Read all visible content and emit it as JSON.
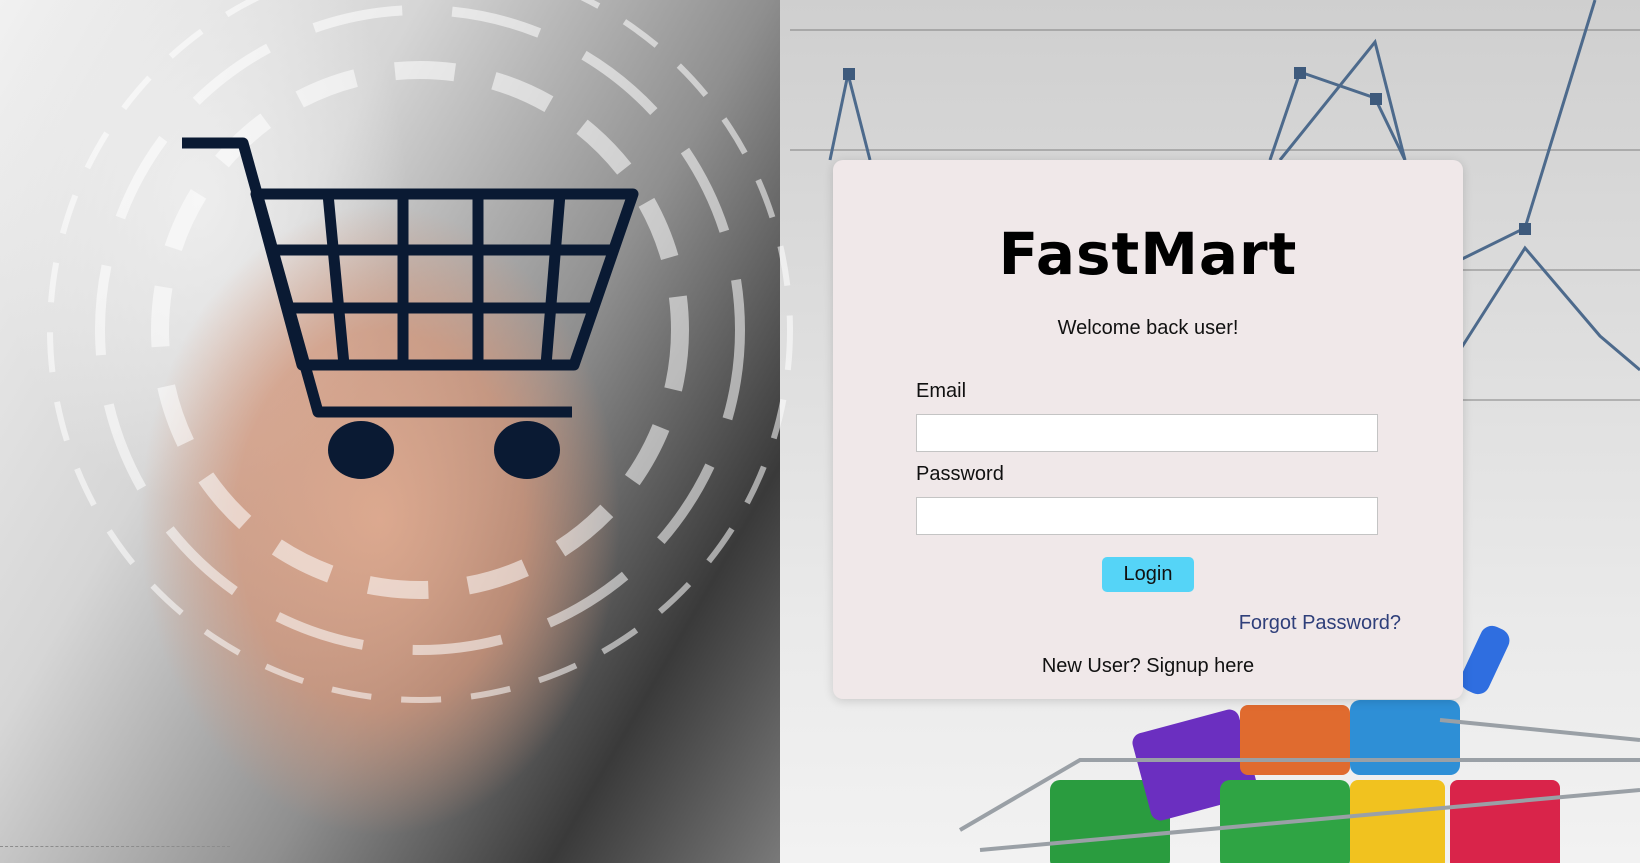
{
  "brand": {
    "name": "FastMart"
  },
  "login": {
    "welcome": "Welcome back user!",
    "email_label": "Email",
    "email_value": "",
    "password_label": "Password",
    "password_value": "",
    "login_button": "Login",
    "forgot_password": "Forgot Password?",
    "signup": "New User? Signup here"
  },
  "colors": {
    "card_background": "#f0e8e9",
    "login_button": "#55d4f7",
    "link": "#2f3f7a",
    "cart_icon": "#0a1a33"
  },
  "icons": {
    "background_cart": "shopping-cart-icon"
  }
}
